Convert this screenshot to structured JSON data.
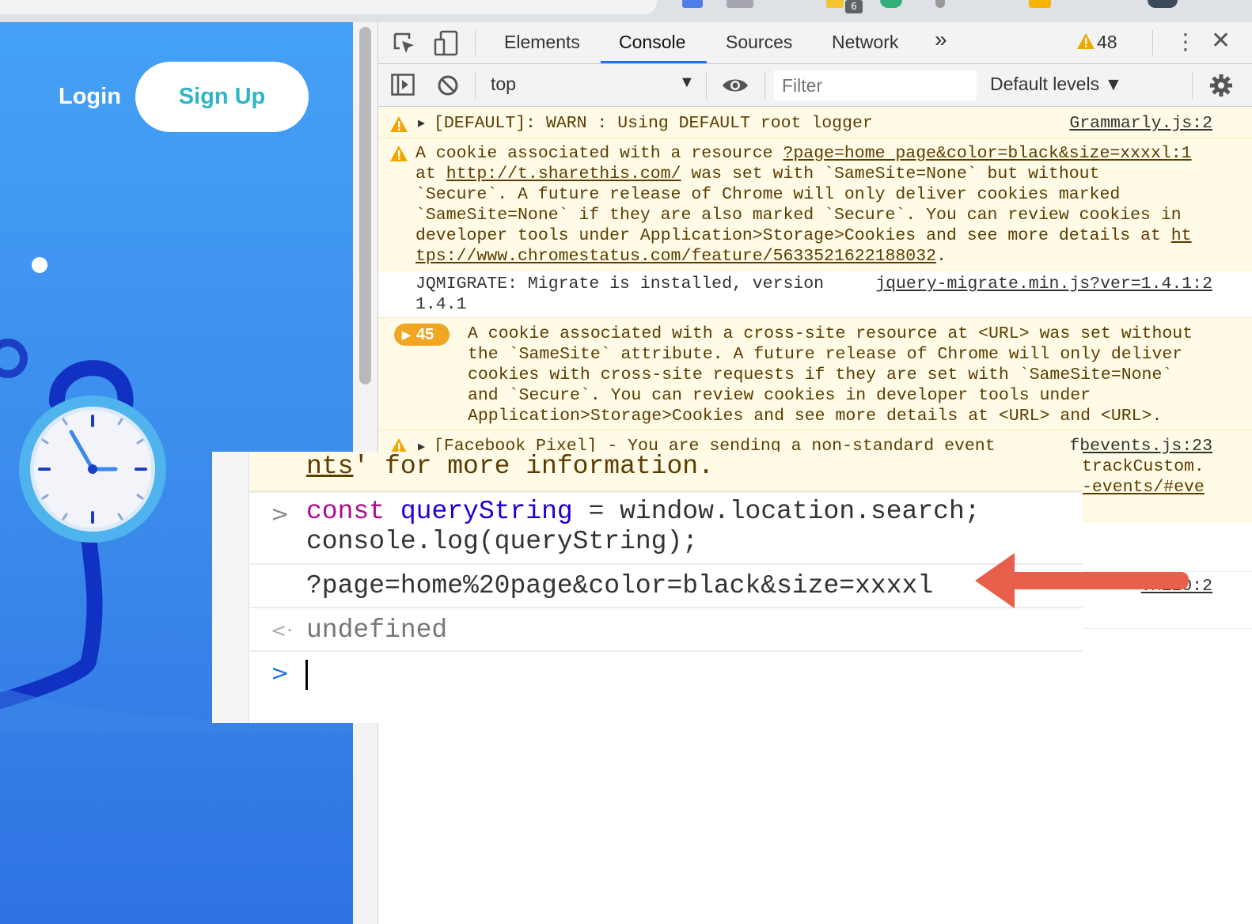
{
  "browser": {
    "extension_badge": "6"
  },
  "site": {
    "login": "Login",
    "signup": "Sign Up"
  },
  "devtools": {
    "tabs": [
      "Elements",
      "Console",
      "Sources",
      "Network"
    ],
    "more_tabs": "»",
    "warnings_count": "48",
    "context": "top",
    "filter_placeholder": "Filter",
    "levels": "Default levels ▼"
  },
  "console": {
    "messages": [
      {
        "type": "warn",
        "text": "[DEFAULT]: WARN : Using DEFAULT root logger",
        "source": "Grammarly.js:2"
      },
      {
        "type": "warn",
        "line1_pre": "A cookie associated with a resource ",
        "line1_link": "?page=home page&color=black&size=xxxxl:1",
        "line2_pre": "at ",
        "line2_link": "http://t.sharethis.com/",
        "line2_post": " was set with `SameSite=None` but without",
        "line3": "`Secure`. A future release of Chrome will only deliver cookies marked",
        "line4": "`SameSite=None` if they are also marked `Secure`. You can review cookies in",
        "line5_pre": "developer tools under Application>Storage>Cookies and see more details at ",
        "line5_link": "ht",
        "line6_link": "tps://www.chromestatus.com/feature/5633521622188032",
        "line6_post": "."
      },
      {
        "type": "log",
        "line1": "JQMIGRATE: Migrate is installed, version",
        "line2": "1.4.1",
        "source": "jquery-migrate.min.js?ver=1.4.1:2"
      },
      {
        "type": "warn-group",
        "count": "45",
        "lines": [
          "A cookie associated with a cross-site resource at <URL> was set without",
          "the `SameSite` attribute. A future release of Chrome will only deliver",
          "cookies with cross-site requests if they are set with `SameSite=None`",
          "and `Secure`. You can review cookies in developer tools under",
          "Application>Storage>Cookies and see more details at <URL> and <URL>."
        ]
      },
      {
        "type": "warn",
        "text": "[Facebook Pixel] - You are sending a non-standard event",
        "source": "fbevents.js:23"
      }
    ],
    "right_slices": [
      "trackCustom.",
      "-events/#eve"
    ],
    "vm_source": "VM120:2"
  },
  "zoom": {
    "warn_tail_link": "nts",
    "warn_tail_rest": "' for more information.",
    "input_kw": "const",
    "input_var": "queryString",
    "input_rest": " = window.location.search;",
    "input_line2": "console.log(queryString);",
    "output": "?page=home%20page&color=black&size=xxxxl",
    "return_value": "undefined",
    "prompt_glyph": ">",
    "return_glyph": "<·"
  },
  "colors": {
    "annotation_arrow": "#e8604c",
    "accent": "#1a73e8",
    "warn_bg": "#fffbe6",
    "site_blue": "#3a8aeb"
  }
}
